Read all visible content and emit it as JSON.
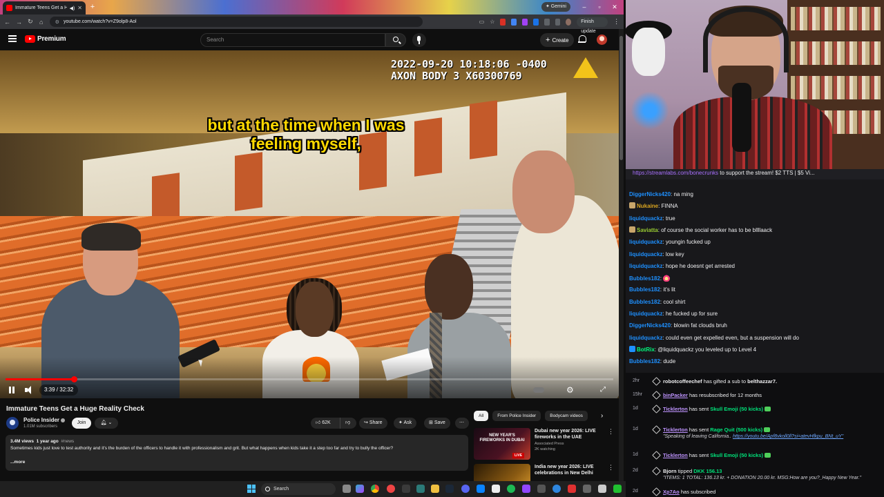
{
  "browser": {
    "tab_title": "Immature Teens Get a Huge",
    "tab_audio_icon": "speaker-icon",
    "gemini_label": "✦ Gemini",
    "url": "youtube.com/watch?v=Z9olp8-Aol",
    "finish_update_label": "Finish update"
  },
  "youtube": {
    "logo_text": "Premium",
    "search_placeholder": "Search",
    "create_label": "Create"
  },
  "video": {
    "bodycam_stamp": "2022-09-20 10:18:06 -0400\nAXON BODY 3 X60300769",
    "caption_line1": "but at the time when I was",
    "caption_line2": "feeling myself,",
    "current_time": "3:39",
    "duration": "32:32",
    "time_display": "3:39 / 32:32",
    "progress_fraction": 0.112,
    "title": "Immature Teens Get a Huge Reality Check"
  },
  "channel": {
    "name": "Police Insider",
    "subscribers": "1.01M subscribers",
    "join_label": "Join"
  },
  "actions": {
    "like_count": "62K",
    "share_label": "Share",
    "ask_label": "Ask",
    "save_label": "Save"
  },
  "description": {
    "views": "3.4M views",
    "age": "1 year ago",
    "hashtag": "#news",
    "text": "Sometimes kids just love to test authority and it's the burden of the officers to handle it with professionalism and grit. But what happens when kids take it a step too far and try to bully the officer?",
    "more_label": "...more"
  },
  "chips": [
    "All",
    "From Police Insider",
    "Bodycam videos"
  ],
  "recommendations": [
    {
      "title": "Dubai new year 2026: LIVE fireworks in the UAE",
      "channel": "Associated Press",
      "views": "2K watching",
      "thumb_text": "NEW YEAR'S FIREWORKS IN DUBAI",
      "live": "LIVE",
      "thumb_color": "#3a0f1a"
    },
    {
      "title": "India new year 2026: LIVE celebrations in New Delhi",
      "channel": "",
      "views": "",
      "thumb_text": "",
      "live": "",
      "thumb_color": "#7a4b10"
    }
  ],
  "chat": {
    "banner_link": "https://streamlabs.com/bonecrunks",
    "banner_rest": " to support the stream! $2 TTS | $5 Vi...",
    "messages": [
      {
        "user": "DiggerNicks420",
        "text": "na ming",
        "color": "#1e90ff",
        "badge": ""
      },
      {
        "user": "Nukaine",
        "text": "FINNA",
        "color": "#daa520",
        "badge": "#c9a66b"
      },
      {
        "user": "liquidquackz",
        "text": "true",
        "color": "#1e90ff",
        "badge": ""
      },
      {
        "user": "Saviatta",
        "text": "of course the social worker has to be bllllaack",
        "color": "#9acd32",
        "badge": "#c9a66b"
      },
      {
        "user": "liquidquackz",
        "text": "youngin fucked up",
        "color": "#1e90ff",
        "badge": ""
      },
      {
        "user": "liquidquackz",
        "text": "low key",
        "color": "#1e90ff",
        "badge": ""
      },
      {
        "user": "liquidquackz",
        "text": "hope he doesnt get arrested",
        "color": "#1e90ff",
        "badge": ""
      },
      {
        "user": "Bubbles182",
        "text": "",
        "color": "#1e90ff",
        "badge": "",
        "emote": "fire-emote"
      },
      {
        "user": "Bubbles182",
        "text": "it's lit",
        "color": "#1e90ff",
        "badge": ""
      },
      {
        "user": "Bubbles182",
        "text": "cool shirt",
        "color": "#1e90ff",
        "badge": ""
      },
      {
        "user": "liquidquackz",
        "text": "he fucked up for sure",
        "color": "#1e90ff",
        "badge": ""
      },
      {
        "user": "DiggerNicks420",
        "text": "blowin fat clouds bruh",
        "color": "#1e90ff",
        "badge": ""
      },
      {
        "user": "liquidquackz",
        "text": "could even get expelled even, but a suspension will do",
        "color": "#1e90ff",
        "badge": ""
      },
      {
        "user": "BotRix",
        "text": "@liquidquackz you leveled up to Level 4",
        "color": "#00ff7f",
        "badge": "#1e90ff"
      },
      {
        "user": "Bubbles182",
        "text": "dude",
        "color": "#1e90ff",
        "badge": ""
      }
    ]
  },
  "events": [
    {
      "age": "2hr",
      "user": "robotcoffeechef",
      "plain_user": true,
      "pre": "",
      "mid": " has gifted a sub to ",
      "target": "belthazzar7.",
      "hl": "",
      "kick": false,
      "sub": ""
    },
    {
      "age": "15hr",
      "user": "binPacker",
      "plain_user": false,
      "pre": "",
      "mid": " has resubscribed for 12 months",
      "target": "",
      "hl": "",
      "kick": false,
      "sub": ""
    },
    {
      "age": "1d",
      "user": "Ticklerton",
      "plain_user": false,
      "pre": "",
      "mid": " has sent ",
      "target": "",
      "hl": "Skull Emoji (50 kicks)",
      "kick": true,
      "sub": ""
    },
    {
      "age": "1d",
      "user": "Ticklerton",
      "plain_user": false,
      "pre": "",
      "mid": " has sent ",
      "target": "",
      "hl": "Rage Quit (500 kicks)",
      "kick": true,
      "sub": "\"Speaking of leaving California..",
      "sub_link": "https://youtu.be/Apf8vkoll0ll?si=atevHfkpu_BNt_uY\""
    },
    {
      "age": "1d",
      "user": "Ticklerton",
      "plain_user": false,
      "pre": "",
      "mid": " has sent ",
      "target": "",
      "hl": "Skull Emoji (50 kicks)",
      "kick": true,
      "sub": ""
    },
    {
      "age": "2d",
      "user": "Bjorn",
      "plain_user": true,
      "pre": "",
      "mid": " tipped ",
      "target": "",
      "hl": "DKK 156.13",
      "kick": false,
      "sub": "\"ITEMS: 1 TOTAL: 136.13 kr. + DONATION 20.00 kr. MSG:How are you?_Happy New Year.\"",
      "sub_link": ""
    },
    {
      "age": "2d",
      "user": "Xp7Ao",
      "plain_user": false,
      "pre": "",
      "mid": " has subscribed",
      "target": "",
      "hl": "",
      "kick": false,
      "sub": ""
    }
  ],
  "taskbar": {
    "search_label": "Search"
  }
}
